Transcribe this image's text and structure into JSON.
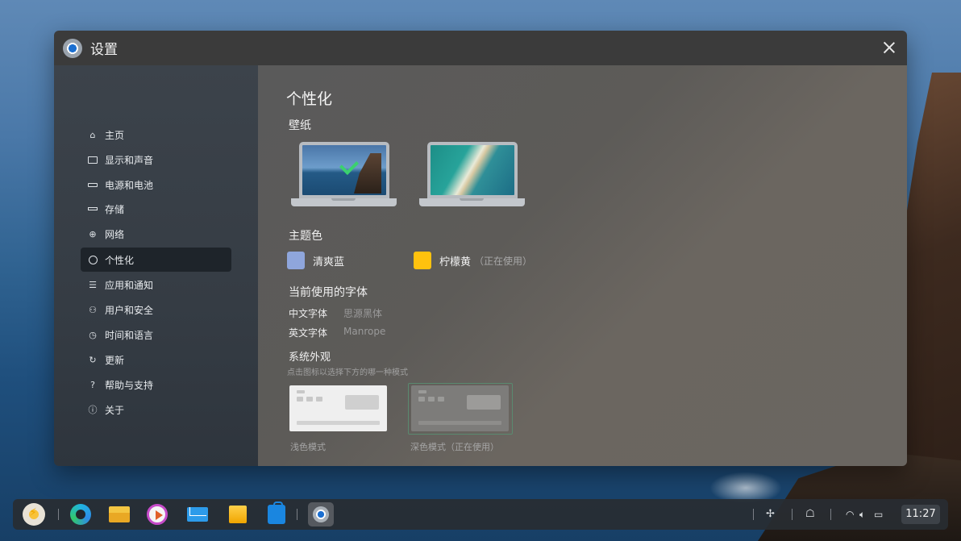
{
  "window": {
    "title": "设置"
  },
  "sidebar": {
    "items": [
      {
        "label": "主页",
        "icon": "home-icon"
      },
      {
        "label": "显示和声音",
        "icon": "monitor-icon"
      },
      {
        "label": "电源和电池",
        "icon": "battery-icon"
      },
      {
        "label": "存储",
        "icon": "storage-icon"
      },
      {
        "label": "网络",
        "icon": "globe-icon"
      },
      {
        "label": "个性化",
        "icon": "palette-icon",
        "active": true
      },
      {
        "label": "应用和通知",
        "icon": "list-icon"
      },
      {
        "label": "用户和安全",
        "icon": "user-icon"
      },
      {
        "label": "时间和语言",
        "icon": "clock-icon"
      },
      {
        "label": "更新",
        "icon": "refresh-icon"
      },
      {
        "label": "帮助与支持",
        "icon": "help-icon"
      },
      {
        "label": "关于",
        "icon": "info-icon"
      }
    ]
  },
  "content": {
    "page_title": "个性化",
    "wallpaper": {
      "heading": "壁纸"
    },
    "theme": {
      "heading": "主题色",
      "options": [
        {
          "label": "清爽蓝",
          "color": "#8fa6dc",
          "note": ""
        },
        {
          "label": "柠檬黄",
          "color": "#ffc20e",
          "note": "（正在使用）"
        }
      ]
    },
    "fonts": {
      "heading": "当前使用的字体",
      "rows": [
        {
          "key": "中文字体",
          "value": "思源黑体"
        },
        {
          "key": "英文字体",
          "value": "Manrope"
        }
      ]
    },
    "appearance": {
      "heading": "系统外观",
      "hint": "点击图标以选择下方的哪一种模式",
      "light_label": "浅色模式",
      "dark_label": "深色模式（正在使用）"
    }
  },
  "taskbar": {
    "clock": "11:27"
  },
  "colors": {
    "accent": "#ffc20e",
    "active_nav": "#1e242a"
  }
}
